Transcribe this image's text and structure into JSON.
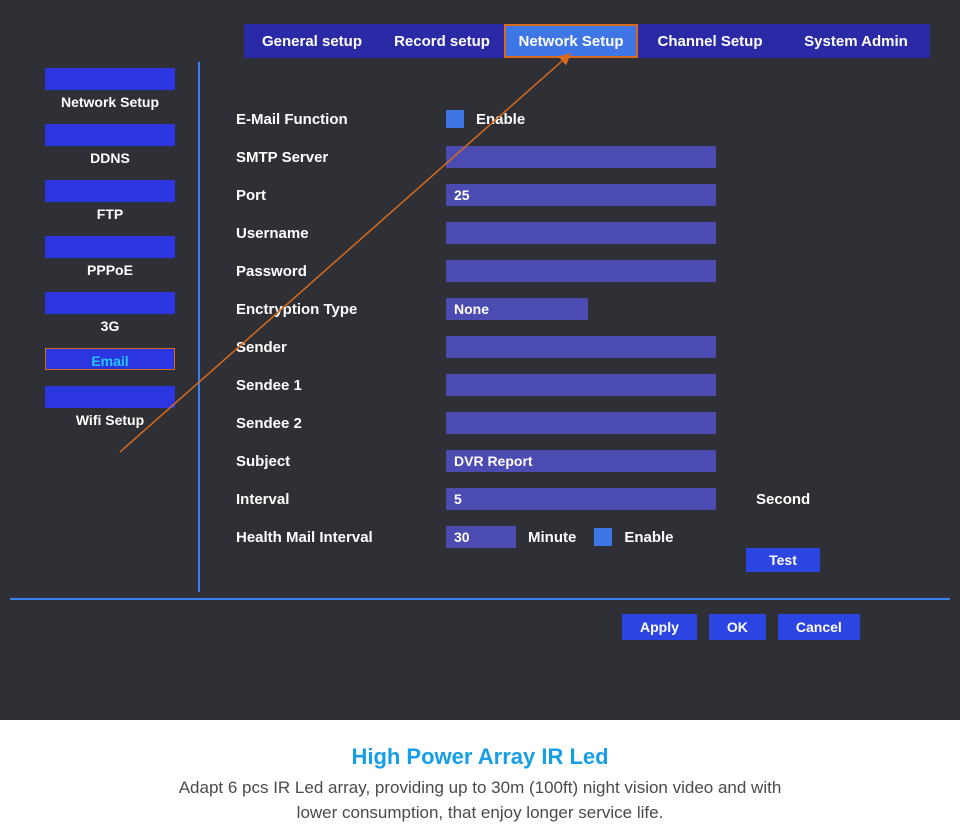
{
  "tabs": {
    "general": "General setup",
    "record": "Record setup",
    "network": "Network Setup",
    "channel": "Channel Setup",
    "system": "System Admin"
  },
  "sidebar": [
    {
      "label": "Network  Setup"
    },
    {
      "label": "DDNS"
    },
    {
      "label": "FTP"
    },
    {
      "label": "PPPoE"
    },
    {
      "label": "3G"
    },
    {
      "label": "Email"
    },
    {
      "label": "Wifi Setup"
    }
  ],
  "form": {
    "email_function_label": "E-Mail Function",
    "email_function_enable_text": "Enable",
    "smtp_label": "SMTP Server",
    "smtp_value": "",
    "port_label": "Port",
    "port_value": "25",
    "username_label": "Username",
    "username_value": "",
    "password_label": "Password",
    "password_value": "",
    "encryption_label": "Enctryption Type",
    "encryption_value": "None",
    "sender_label": "Sender",
    "sender_value": "",
    "sendee1_label": "Sendee 1",
    "sendee1_value": "",
    "sendee2_label": "Sendee 2",
    "sendee2_value": "",
    "subject_label": "Subject",
    "subject_value": "DVR Report",
    "interval_label": "Interval",
    "interval_value": "5",
    "interval_unit": "Second",
    "health_label": "Health Mail Interval",
    "health_value": "30",
    "health_unit": "Minute",
    "health_enable_text": "Enable"
  },
  "buttons": {
    "test": "Test",
    "apply": "Apply",
    "ok": "OK",
    "cancel": "Cancel"
  },
  "caption": {
    "title": "High Power Array IR Led",
    "body": "Adapt 6 pcs IR Led array, providing up to 30m (100ft) night vision video and with lower consumption, that enjoy longer service life."
  }
}
